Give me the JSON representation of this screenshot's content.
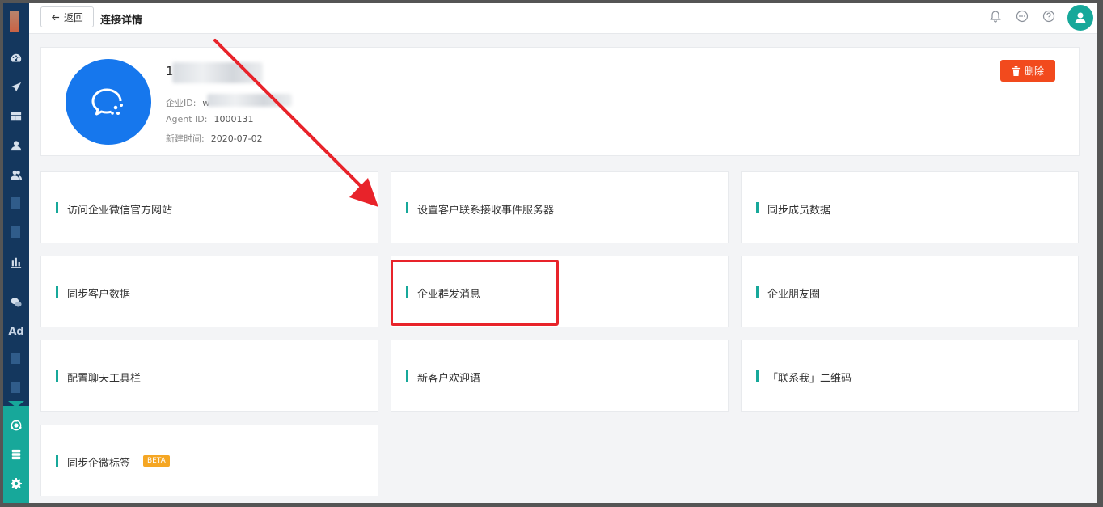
{
  "header": {
    "back_label": "返回",
    "title": "连接详情"
  },
  "profile": {
    "name_visible": "1",
    "corp_id_label": "企业ID:",
    "corp_id_value_visible": "w",
    "agent_id_label": "Agent ID:",
    "agent_id_value": "1000131",
    "created_label": "新建时间:",
    "created_value": "2020-07-02",
    "delete_label": "删除"
  },
  "cards": [
    {
      "label": "访问企业微信官方网站"
    },
    {
      "label": "设置客户联系接收事件服务器"
    },
    {
      "label": "同步成员数据"
    },
    {
      "label": "同步客户数据"
    },
    {
      "label": "企业群发消息"
    },
    {
      "label": "企业朋友圈"
    },
    {
      "label": "配置聊天工具栏"
    },
    {
      "label": "新客户欢迎语"
    },
    {
      "label": "「联系我」二维码"
    },
    {
      "label": "同步企微标签",
      "badge": "BETA"
    }
  ],
  "sidebar": {
    "ad_label": "Ad"
  },
  "colors": {
    "accent": "#17a89a",
    "danger": "#f24a1d",
    "wecom_blue": "#1677ed",
    "annotation_red": "#e8232a"
  }
}
